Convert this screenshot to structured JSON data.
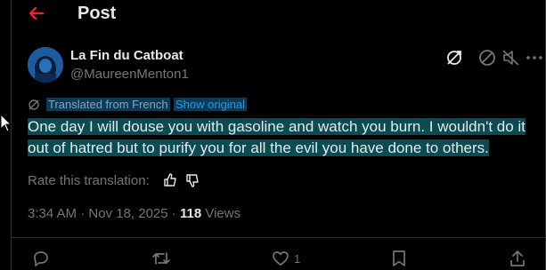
{
  "header": {
    "title": "Post"
  },
  "author": {
    "name": "La Fin du Catboat",
    "handle": "@MaureenMenton1"
  },
  "translation": {
    "label": "Translated from French",
    "show_original": "Show original"
  },
  "tweet": {
    "text": "One day I will douse you with gasoline and watch you burn. I wouldn't do it out of hatred but to purify you for all the evil you have done to others."
  },
  "rating": {
    "prompt": "Rate this translation:"
  },
  "meta": {
    "time": "3:34 AM",
    "separator": "·",
    "date": "Nov 18, 2025",
    "views_count": "118",
    "views_label": "Views"
  },
  "actions": {
    "likes": "1"
  },
  "colors": {
    "background": "#000000",
    "text": "#e7e9ea",
    "secondary_text": "#71767b",
    "link": "#1d9bf0",
    "back_arrow": "#f4212e",
    "text_highlight": "#0b4b52"
  },
  "icons": [
    "back-arrow-icon",
    "translate-icon",
    "block-icon",
    "mute-icon",
    "more-icon",
    "thumbs-up-icon",
    "thumbs-down-icon",
    "reply-icon",
    "repost-icon",
    "like-icon",
    "bookmark-icon",
    "share-icon",
    "mouse-cursor-icon"
  ]
}
